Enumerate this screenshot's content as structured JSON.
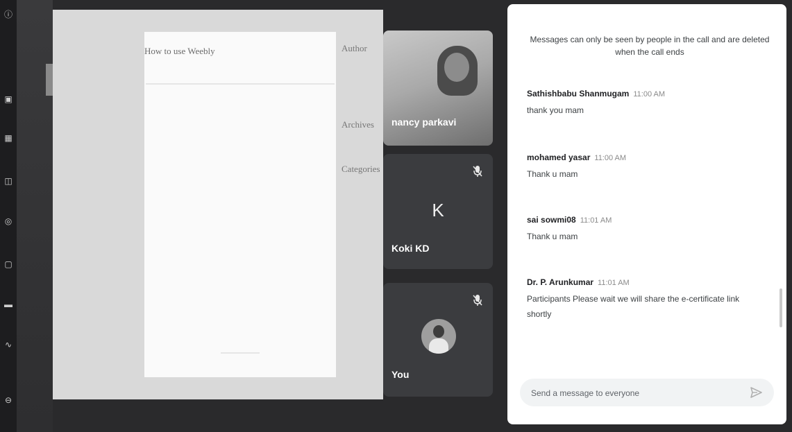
{
  "rail": {
    "icons": [
      "info-icon",
      "chat-icon",
      "grid-icon",
      "box-icon",
      "settings-icon",
      "lock-icon",
      "menu-icon",
      "wave-icon",
      "user-icon"
    ]
  },
  "presentation": {
    "page_title": "How to use Weebly",
    "sidebar_labels": [
      "Author",
      "Archives",
      "Categories"
    ]
  },
  "participants": [
    {
      "name": "nancy parkavi",
      "muted": false,
      "type": "video"
    },
    {
      "name": "Koki KD",
      "initial": "K",
      "muted": true,
      "type": "initial"
    },
    {
      "name": "You",
      "muted": true,
      "type": "avatar"
    }
  ],
  "chat": {
    "notice": "Messages can only be seen by people in the call and are deleted when the call ends",
    "messages": [
      {
        "sender": "Sathishbabu Shanmugam",
        "time": "11:00 AM",
        "text": "thank you mam"
      },
      {
        "sender": "mohamed yasar",
        "time": "11:00 AM",
        "text": "Thank u mam"
      },
      {
        "sender": "sai sowmi08",
        "time": "11:01 AM",
        "text": "Thank u mam"
      },
      {
        "sender": "Dr. P. Arunkumar",
        "time": "11:01 AM",
        "text": "Participants Please wait we will share the e-certificate link shortly"
      }
    ],
    "composer_placeholder": "Send a message to everyone"
  }
}
